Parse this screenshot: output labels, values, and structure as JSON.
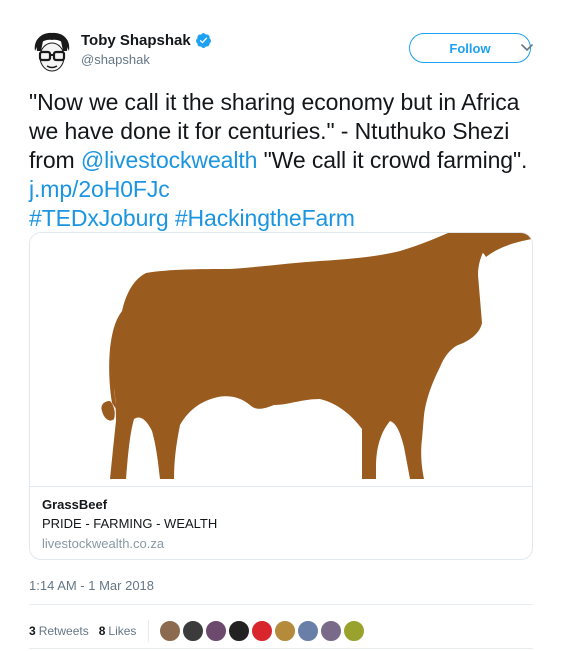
{
  "user": {
    "name": "Toby Shapshak",
    "handle": "@shapshak",
    "verified": true
  },
  "follow_button": {
    "label": "Follow"
  },
  "menu": {
    "icon": "chevron-down-icon"
  },
  "tweet": {
    "parts": {
      "p1": "\"Now we call it the sharing economy but in Africa we have done it for centuries.\" - Ntuthuko Shezi from ",
      "mention": "@livestockwealth",
      "p2": " \"We call it crowd farming\". ",
      "url": "j.mp/2oH0FJc",
      "hashtag1": "#TEDxJoburg",
      "hashtag2": "#HackingtheFarm"
    }
  },
  "card": {
    "image_subject": "brown cow silhouette",
    "title": "GrassBeef",
    "description": "PRIDE - FARMING - WEALTH",
    "domain": "livestockwealth.co.za"
  },
  "timestamp": "1:14 AM - 1 Mar 2018",
  "stats": {
    "retweets_count": "3",
    "retweets_label": "Retweets",
    "likes_count": "8",
    "likes_label": "Likes"
  },
  "liker_avatars": [
    {
      "color": "#8b6a4f"
    },
    {
      "color": "#3b3b3b"
    },
    {
      "color": "#6b4a6e"
    },
    {
      "color": "#222222"
    },
    {
      "color": "#d8262c"
    },
    {
      "color": "#b58a3a"
    },
    {
      "color": "#6a7fa8"
    },
    {
      "color": "#7a6a8a"
    },
    {
      "color": "#9aa22e"
    }
  ],
  "colors": {
    "link": "#1b95e0",
    "follow": "#1da1f2",
    "cow": "#9a5b1f"
  }
}
